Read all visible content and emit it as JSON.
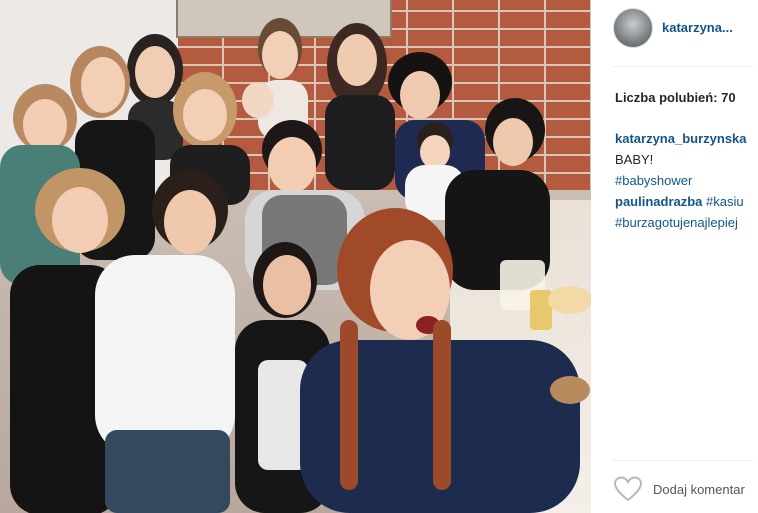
{
  "post": {
    "photo_alt": "",
    "username": "katarzyna...",
    "likes_label": "Liczba polubień: 70",
    "comments": [
      {
        "author": "katarzyna_burzynska",
        "lines": [
          "BABY!"
        ],
        "hashtags": [
          "#babyshower"
        ]
      },
      {
        "author": "paulinadrazba",
        "inline_hashtag": "#kasiu",
        "hashtags": [
          "#burzagotujenajlepiej"
        ]
      }
    ],
    "add_comment_placeholder": "Dodaj komentar"
  },
  "colors": {
    "link_blue": "#125688",
    "text_dark": "#262626",
    "divider": "#efefef"
  },
  "icons": {
    "like": "heart-outline-icon"
  }
}
